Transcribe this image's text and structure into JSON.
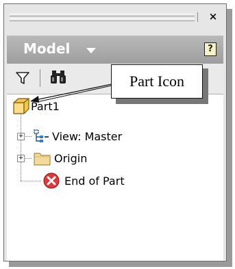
{
  "panel": {
    "close_glyph": "×",
    "header": {
      "title": "Model",
      "help_glyph": "?"
    },
    "toolbar": {
      "filter_icon": "filter-icon",
      "find_icon": "binoculars-icon"
    }
  },
  "tree": {
    "root": {
      "label": "Part1",
      "icon": "part-cube-icon"
    },
    "children": [
      {
        "label": "View: Master",
        "icon": "view-representation-icon",
        "expandable": true
      },
      {
        "label": "Origin",
        "icon": "folder-icon",
        "expandable": true
      },
      {
        "label": "End of Part",
        "icon": "end-of-part-icon",
        "expandable": false
      }
    ],
    "expander_glyph": "+"
  },
  "callout": {
    "text": "Part Icon"
  },
  "colors": {
    "header_bg": "#a9a9a9",
    "panel_bg": "#e6e6e6",
    "folder": "#f3d99a",
    "part_cube": "#f5c64a",
    "end_of_part": "#e0383a"
  }
}
